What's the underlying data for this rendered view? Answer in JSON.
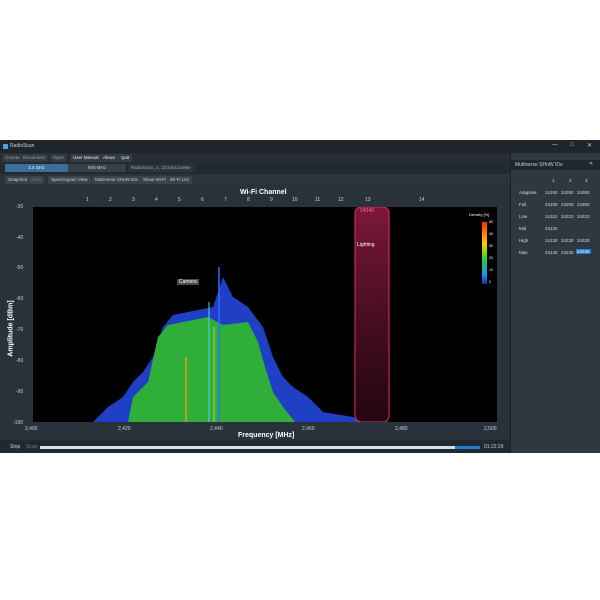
{
  "window": {
    "title": "RadioScan",
    "controls": [
      "—",
      "□",
      "✕"
    ]
  },
  "menu": {
    "connect": "Connect",
    "disconnect": "Disconnect",
    "open": "Open",
    "user_manual": "User Manual",
    "about": "About",
    "quit": "Quit"
  },
  "bands": {
    "band_a": "2.4 GHz",
    "band_b": "900 MHz",
    "file_tab": "RadioScan_2...223454.banne"
  },
  "views": {
    "snapshot": "Snapshot",
    "save": "Save",
    "spectrogram": "Spectrogram View",
    "multiverse": "Multiverse SHoW IDs",
    "show_wifi": "Show Wi-Fi",
    "wifi_list": "Wi-Fi List"
  },
  "plot": {
    "top_title": "Wi-Fi Channel",
    "ylabel": "Amplitude [dBm]",
    "xlabel": "Frequency [MHz]",
    "channels": [
      "1",
      "2",
      "3",
      "4",
      "5",
      "6",
      "7",
      "8",
      "9",
      "10",
      "11",
      "12",
      "13",
      "14"
    ],
    "yticks": [
      "-30",
      "-40",
      "-50",
      "-60",
      "-70",
      "-80",
      "-90",
      "-100"
    ],
    "xticks": [
      "2,400",
      "2,420",
      "2,440",
      "2,460",
      "2,480",
      "2,500"
    ],
    "annotation_camera": "Camera",
    "annotation_lighting": "Lighting",
    "lighting_id": "24340",
    "density_title": "Density [%]",
    "density_ticks": [
      "50",
      "40",
      "30",
      "20",
      "10",
      "0"
    ]
  },
  "bottom": {
    "stop": "Stop",
    "scan": "Scan",
    "time": "01:22:29"
  },
  "panel": {
    "title": "Multiverse SHoW IDs",
    "cols": [
      "1",
      "2",
      "3"
    ],
    "rows": [
      {
        "label": "Adaptive",
        "values": [
          "24150",
          "24250",
          "24350"
        ]
      },
      {
        "label": "Full",
        "values": [
          "24100",
          "24200",
          "24300"
        ]
      },
      {
        "label": "Low",
        "values": [
          "24110",
          "24210",
          "24310"
        ]
      },
      {
        "label": "Mid",
        "values": [
          "24120",
          "",
          ""
        ]
      },
      {
        "label": "High",
        "values": [
          "24130",
          "24230",
          "24330"
        ]
      },
      {
        "label": "Max",
        "values": [
          "24140",
          "24240",
          "24340"
        ]
      }
    ]
  },
  "colors": {
    "accent": "#1e7fd1",
    "lighting": "#e0306a",
    "background": "#2b333b"
  }
}
